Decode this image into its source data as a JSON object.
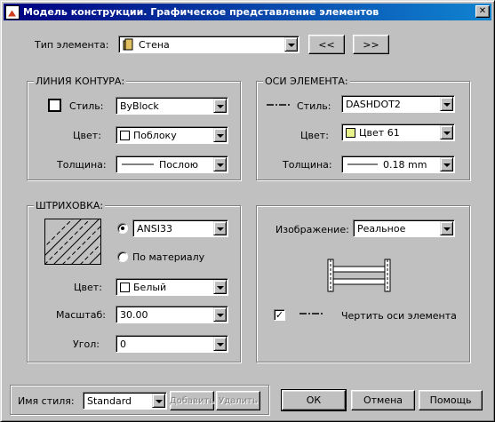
{
  "window": {
    "title": "Модель конструкции. Графическое представление элементов",
    "close_glyph": "✕"
  },
  "element_type": {
    "label": "Тип элемента:",
    "value": "Стена",
    "prev_label": "<<",
    "next_label": ">>"
  },
  "contour": {
    "title": "ЛИНИЯ КОНТУРА:",
    "style_label": "Стиль:",
    "style_value": "ByBlock",
    "color_label": "Цвет:",
    "color_value": "Поблоку",
    "color_swatch": "#ffffff",
    "thickness_label": "Толщина:",
    "thickness_value": "Послою"
  },
  "axes": {
    "title": "ОСИ ЭЛЕМЕНТА:",
    "style_label": "Стиль:",
    "style_value": "DASHDOT2",
    "color_label": "Цвет:",
    "color_value": "Цвет 61",
    "color_swatch": "#e8f28c",
    "thickness_label": "Толщина:",
    "thickness_value": "0.18 mm"
  },
  "hatch": {
    "title": "ШТРИХОВКА:",
    "pattern_value": "ANSI33",
    "by_material_label": "По материалу",
    "color_label": "Цвет:",
    "color_value": "Белый",
    "color_swatch": "#ffffff",
    "scale_label": "Масштаб:",
    "scale_value": "30.00",
    "angle_label": "Угол:",
    "angle_value": "0"
  },
  "display": {
    "image_label": "Изображение:",
    "image_value": "Реальное",
    "draw_axes_label": "Чертить оси элемента",
    "draw_axes_checked": "✓"
  },
  "footer": {
    "style_name_label": "Имя стиля:",
    "style_name_value": "Standard",
    "add_label": "Добавить",
    "delete_label": "Удалить",
    "ok_label": "ОК",
    "cancel_label": "Отмена",
    "help_label": "Помощь"
  }
}
